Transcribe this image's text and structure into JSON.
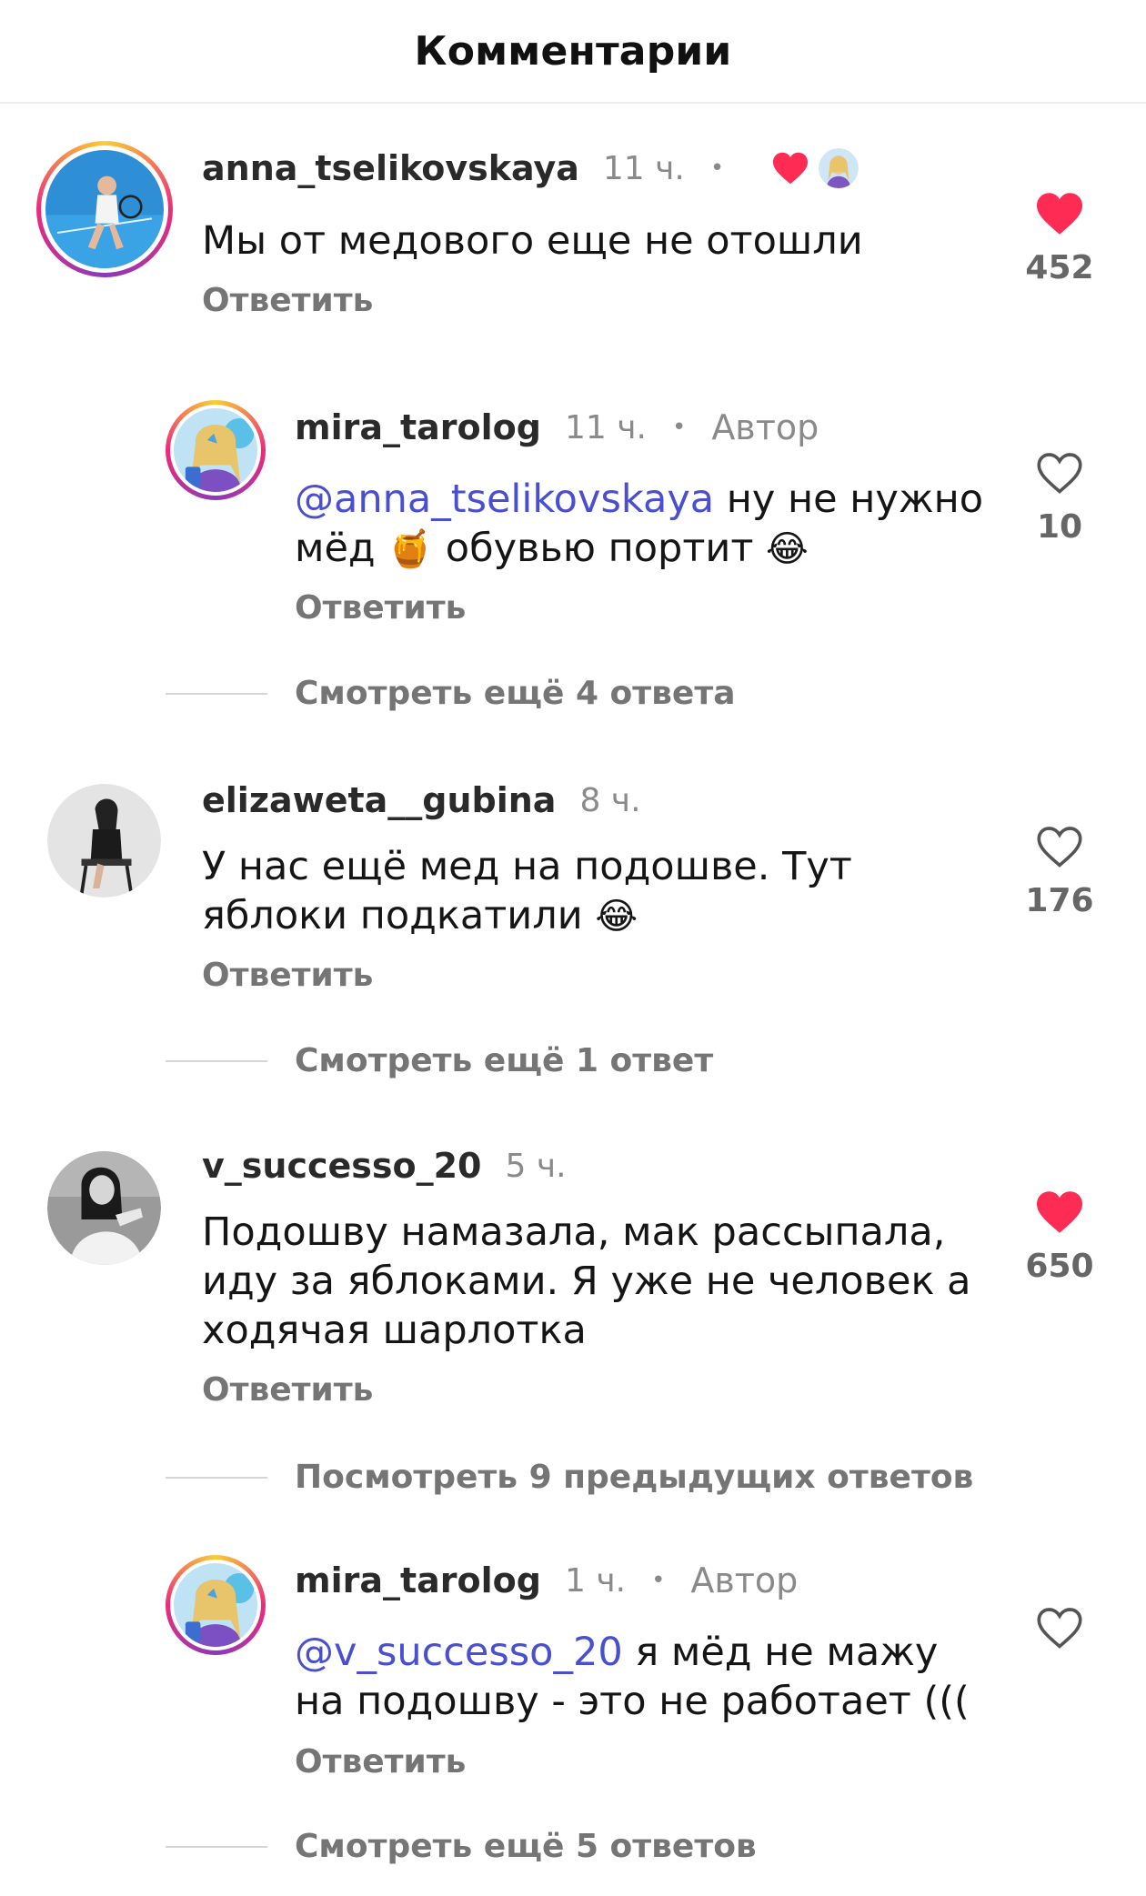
{
  "header": {
    "title": "Комментарии"
  },
  "comments": [
    {
      "username": "anna_tselikovskaya",
      "time": "11 ч.",
      "text": "Мы от медового еще не отошли",
      "reply_label": "Ответить",
      "likes": "452",
      "liked": true,
      "liked_by_author": true
    },
    {
      "username": "mira_tarolog",
      "time": "11 ч.",
      "badge": "Автор",
      "mention": "@anna_tselikovskaya",
      "text_a": " ну не нужно мёд ",
      "emoji_a": "🍯",
      "text_b": " обувью портит ",
      "emoji_b": "😂",
      "reply_label": "Ответить",
      "likes": "10",
      "liked": false
    },
    {
      "username": "elizaweta__gubina",
      "time": "8 ч.",
      "text": "У нас ещё мед на подошве. Тут яблоки подкатили ",
      "emoji": "😂",
      "reply_label": "Ответить",
      "likes": "176",
      "liked": false
    },
    {
      "username": "v_successo_20",
      "time": "5 ч.",
      "text": "Подошву намазала, мак рассыпала, иду за яблоками. Я уже не человек а ходячая шарлотка",
      "reply_label": "Ответить",
      "likes": "650",
      "liked": true
    },
    {
      "username": "mira_tarolog",
      "time": "1 ч.",
      "badge": "Автор",
      "mention": "@v_successo_20",
      "text": " я мёд не мажу на подошву - это не работает (((",
      "reply_label": "Ответить",
      "likes": "",
      "liked": false
    }
  ],
  "view_more": {
    "first": "Смотреть ещё 4 ответа",
    "second": "Смотреть ещё 1 ответ",
    "previous": "Посмотреть 9 предыдущих ответов",
    "last": "Смотреть ещё 5 ответов"
  },
  "colors": {
    "like_red": "#fe2c55",
    "mention_blue": "#4a4fcf",
    "muted": "#757575"
  }
}
